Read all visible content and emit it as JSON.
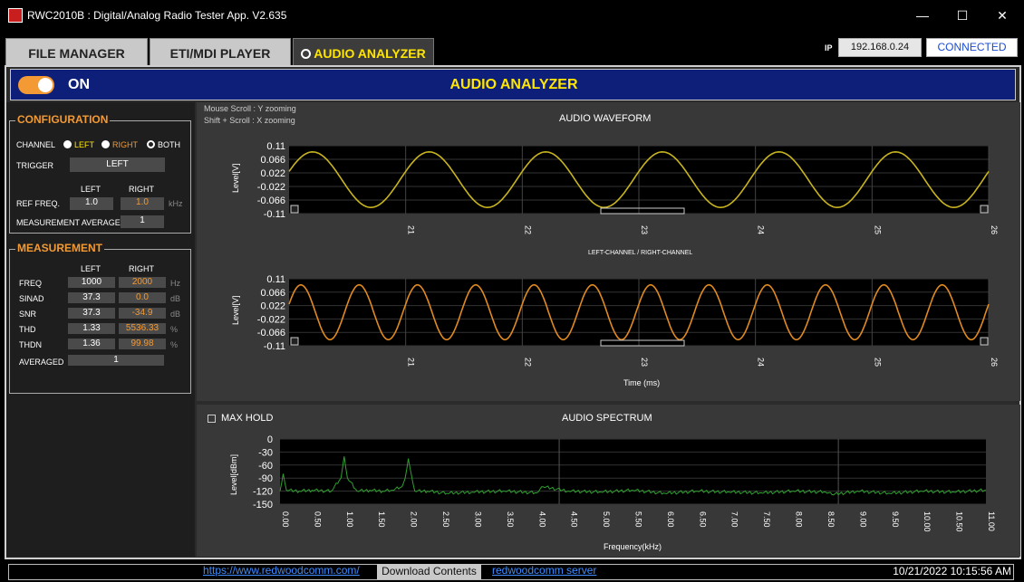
{
  "window": {
    "title": "RWC2010B : Digital/Analog Radio Tester App. V2.635",
    "controls": {
      "minimize": "—",
      "maximize": "☐",
      "close": "✕"
    }
  },
  "tabs": [
    {
      "label": "FILE MANAGER"
    },
    {
      "label": "ETI/MDI PLAYER"
    },
    {
      "label": "AUDIO ANALYZER"
    }
  ],
  "connection": {
    "ip_label": "IP",
    "ip": "192.168.0.24",
    "status": "CONNECTED"
  },
  "header": {
    "toggle_label": "ON",
    "title": "AUDIO ANALYZER"
  },
  "configuration": {
    "title": "CONFIGURATION",
    "channel_label": "CHANNEL",
    "channel_options": [
      "LEFT",
      "RIGHT",
      "BOTH"
    ],
    "trigger_label": "TRIGGER",
    "trigger_value": "LEFT",
    "left_header": "LEFT",
    "right_header": "RIGHT",
    "ref_freq_label": "REF FREQ.",
    "ref_freq_left": "1.0",
    "ref_freq_right": "1.0",
    "ref_freq_unit": "kHz",
    "avg_label": "MEASUREMENT AVERAGE",
    "avg_value": "1"
  },
  "measurement": {
    "title": "MEASUREMENT",
    "left_header": "LEFT",
    "right_header": "RIGHT",
    "rows": [
      {
        "label": "FREQ",
        "left": "1000",
        "right": "2000",
        "unit": "Hz"
      },
      {
        "label": "SINAD",
        "left": "37.3",
        "right": "0.0",
        "unit": "dB"
      },
      {
        "label": "SNR",
        "left": "37.3",
        "right": "-34.9",
        "unit": "dB"
      },
      {
        "label": "THD",
        "left": "1.33",
        "right": "5536.33",
        "unit": "%"
      },
      {
        "label": "THDN",
        "left": "1.36",
        "right": "99.98",
        "unit": "%"
      }
    ],
    "averaged_label": "AVERAGED",
    "averaged_value": "1"
  },
  "waveform": {
    "hint1": "Mouse Scroll : Y zooming",
    "hint2": "Shift + Scroll : X zooming",
    "title": "AUDIO WAVEFORM",
    "ylabel": "Level[V]",
    "channel_caption": "LEFT-CHANNEL  /  RIGHT-CHANNEL",
    "xlabel": "Time (ms)"
  },
  "spectrum": {
    "maxhold_label": "MAX HOLD",
    "title": "AUDIO SPECTRUM",
    "ylabel": "Level[dBm]",
    "xlabel": "Frequency(kHz)"
  },
  "statusbar": {
    "website": "https://www.redwoodcomm.com/",
    "download": "Download Contents",
    "server": "redwoodcomm server",
    "datetime": "10/21/2022 10:15:56 AM"
  },
  "chart_data": [
    {
      "type": "line",
      "title": "AUDIO WAVEFORM",
      "ylabel": "Level[V]",
      "xlabel": "",
      "x_ticks": [
        "21",
        "22",
        "23",
        "24",
        "25",
        "26"
      ],
      "y_ticks": [
        "0.11",
        "0.066",
        "0.022",
        "-0.022",
        "-0.066",
        "-0.11"
      ],
      "xlim": [
        20.0,
        26.0
      ],
      "ylim": [
        -0.11,
        0.11
      ],
      "series": [
        {
          "name": "LEFT-CHANNEL",
          "frequency_khz": 1.0,
          "amplitude_v": 0.09,
          "color": "#c8b41e"
        }
      ]
    },
    {
      "type": "line",
      "title": "",
      "ylabel": "Level[V]",
      "xlabel": "Time (ms)",
      "x_ticks": [
        "21",
        "22",
        "23",
        "24",
        "25",
        "26"
      ],
      "y_ticks": [
        "0.11",
        "0.066",
        "0.022",
        "-0.022",
        "-0.066",
        "-0.11"
      ],
      "xlim": [
        20.0,
        26.0
      ],
      "ylim": [
        -0.11,
        0.11
      ],
      "series": [
        {
          "name": "RIGHT-CHANNEL",
          "frequency_khz": 2.0,
          "amplitude_v": 0.09,
          "color": "#e08a20"
        }
      ]
    },
    {
      "type": "line",
      "title": "AUDIO SPECTRUM",
      "ylabel": "Level[dBm]",
      "xlabel": "Frequency(kHz)",
      "x_ticks": [
        "0.00",
        "0.50",
        "1.00",
        "1.50",
        "2.00",
        "2.50",
        "3.00",
        "3.50",
        "4.00",
        "4.50",
        "5.00",
        "5.50",
        "6.00",
        "6.50",
        "7.00",
        "7.50",
        "8.00",
        "8.50",
        "9.00",
        "9.50",
        "10.00",
        "10.50",
        "11.00"
      ],
      "y_ticks": [
        "0",
        "-30",
        "-60",
        "-90",
        "-120",
        "-150"
      ],
      "xlim": [
        0,
        11
      ],
      "ylim": [
        -150,
        0
      ],
      "series": [
        {
          "name": "",
          "color": "#2fa02f",
          "x": [
            0,
            0.05,
            0.1,
            0.3,
            0.5,
            0.8,
            0.95,
            1.0,
            1.05,
            1.2,
            1.4,
            1.6,
            1.75,
            1.9,
            1.95,
            2.0,
            2.05,
            2.1,
            2.3,
            2.6,
            3.0,
            3.5,
            4.0,
            4.1,
            4.5,
            5.0,
            5.5,
            6.0,
            6.5,
            7.0,
            7.5,
            8.0,
            8.5,
            8.6,
            9.0,
            9.5,
            10.0,
            10.5,
            11.0
          ],
          "y": [
            -120,
            -80,
            -118,
            -120,
            -118,
            -120,
            -90,
            -40,
            -90,
            -120,
            -118,
            -120,
            -118,
            -110,
            -90,
            -45,
            -85,
            -120,
            -120,
            -125,
            -122,
            -120,
            -124,
            -110,
            -120,
            -122,
            -118,
            -125,
            -120,
            -122,
            -124,
            -120,
            -122,
            -128,
            -120,
            -125,
            -120,
            -122,
            -118
          ]
        }
      ]
    }
  ]
}
